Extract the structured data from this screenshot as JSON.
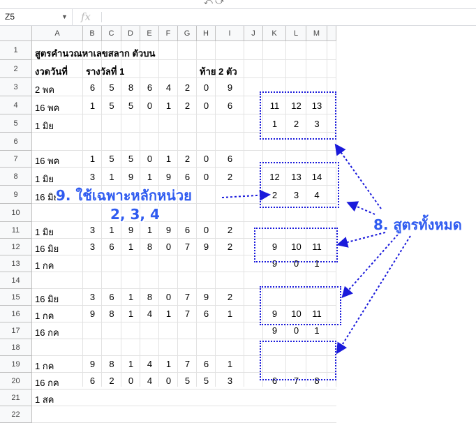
{
  "toolbar": {
    "icons_glyph": "⤺ ⤻",
    "icons_name": "toolbar-icons"
  },
  "formula_bar": {
    "name_box": "Z5",
    "dropdown_glyph": "▼",
    "fx_label": "fx",
    "formula": ""
  },
  "columns": [
    "A",
    "B",
    "C",
    "D",
    "E",
    "F",
    "G",
    "H",
    "I",
    "J",
    "K",
    "L",
    "M",
    ""
  ],
  "rows": [
    "1",
    "2",
    "3",
    "4",
    "5",
    "6",
    "7",
    "8",
    "9",
    "10",
    "11",
    "12",
    "13",
    "14",
    "15",
    "16",
    "17",
    "18",
    "19",
    "20",
    "21",
    "22"
  ],
  "sheet": {
    "title": "สูตรคำนวณหาเลขสลาก ตัวบน",
    "header_date": "งวดวันที่",
    "header_prize": "รางวัลที่ 1",
    "header_last2": "ท้าย 2 ตัว",
    "rows": [
      {
        "r": 3,
        "date": "2 พค",
        "digits": [
          "6",
          "5",
          "8",
          "6",
          "4",
          "2",
          "0",
          "9"
        ]
      },
      {
        "r": 4,
        "date": "16 พค",
        "digits": [
          "1",
          "5",
          "5",
          "0",
          "1",
          "2",
          "0",
          "6"
        ],
        "formula": [
          "11",
          "12",
          "13"
        ]
      },
      {
        "r": 5,
        "date": "1 มิย",
        "formula": [
          "1",
          "2",
          "3"
        ]
      },
      {
        "r": 7,
        "date": "16 พค",
        "digits": [
          "1",
          "5",
          "5",
          "0",
          "1",
          "2",
          "0",
          "6"
        ]
      },
      {
        "r": 8,
        "date": "1 มิย",
        "digits": [
          "3",
          "1",
          "9",
          "1",
          "9",
          "6",
          "0",
          "2"
        ],
        "formula": [
          "12",
          "13",
          "14"
        ]
      },
      {
        "r": 9,
        "date": "16 มิย",
        "formula": [
          "2",
          "3",
          "4"
        ]
      },
      {
        "r": 11,
        "date": "1 มิย",
        "digits": [
          "3",
          "1",
          "9",
          "1",
          "9",
          "6",
          "0",
          "2"
        ]
      },
      {
        "r": 12,
        "date": "16 มิย",
        "digits": [
          "3",
          "6",
          "1",
          "8",
          "0",
          "7",
          "9",
          "2"
        ],
        "formula": [
          "9",
          "10",
          "11"
        ]
      },
      {
        "r": 13,
        "date": "1 กค",
        "formula": [
          "9",
          "0",
          "1"
        ]
      },
      {
        "r": 15,
        "date": "16 มิย",
        "digits": [
          "3",
          "6",
          "1",
          "8",
          "0",
          "7",
          "9",
          "2"
        ]
      },
      {
        "r": 16,
        "date": "1 กค",
        "digits": [
          "9",
          "8",
          "1",
          "4",
          "1",
          "7",
          "6",
          "1"
        ],
        "formula": [
          "9",
          "10",
          "11"
        ]
      },
      {
        "r": 17,
        "date": "16 กค",
        "formula": [
          "9",
          "0",
          "1"
        ]
      },
      {
        "r": 19,
        "date": "1 กค",
        "digits": [
          "9",
          "8",
          "1",
          "4",
          "1",
          "7",
          "6",
          "1"
        ]
      },
      {
        "r": 20,
        "date": "16 กค",
        "digits": [
          "6",
          "2",
          "0",
          "4",
          "0",
          "5",
          "5",
          "3"
        ],
        "formula": [
          "6",
          "7",
          "8"
        ]
      },
      {
        "r": 21,
        "date": "1 สค"
      }
    ]
  },
  "annotations": {
    "units_line1": "9. ใช้เฉพาะหลักหน่วย",
    "units_line2": "2, 3, 4",
    "all_formulas": "8. สูตรทั้งหมด"
  },
  "colors": {
    "annotation": "#2f5bf0",
    "box_border": "#1a1adb",
    "header_bg": "#f8f9fa",
    "grid_line": "#e2e2e2"
  }
}
